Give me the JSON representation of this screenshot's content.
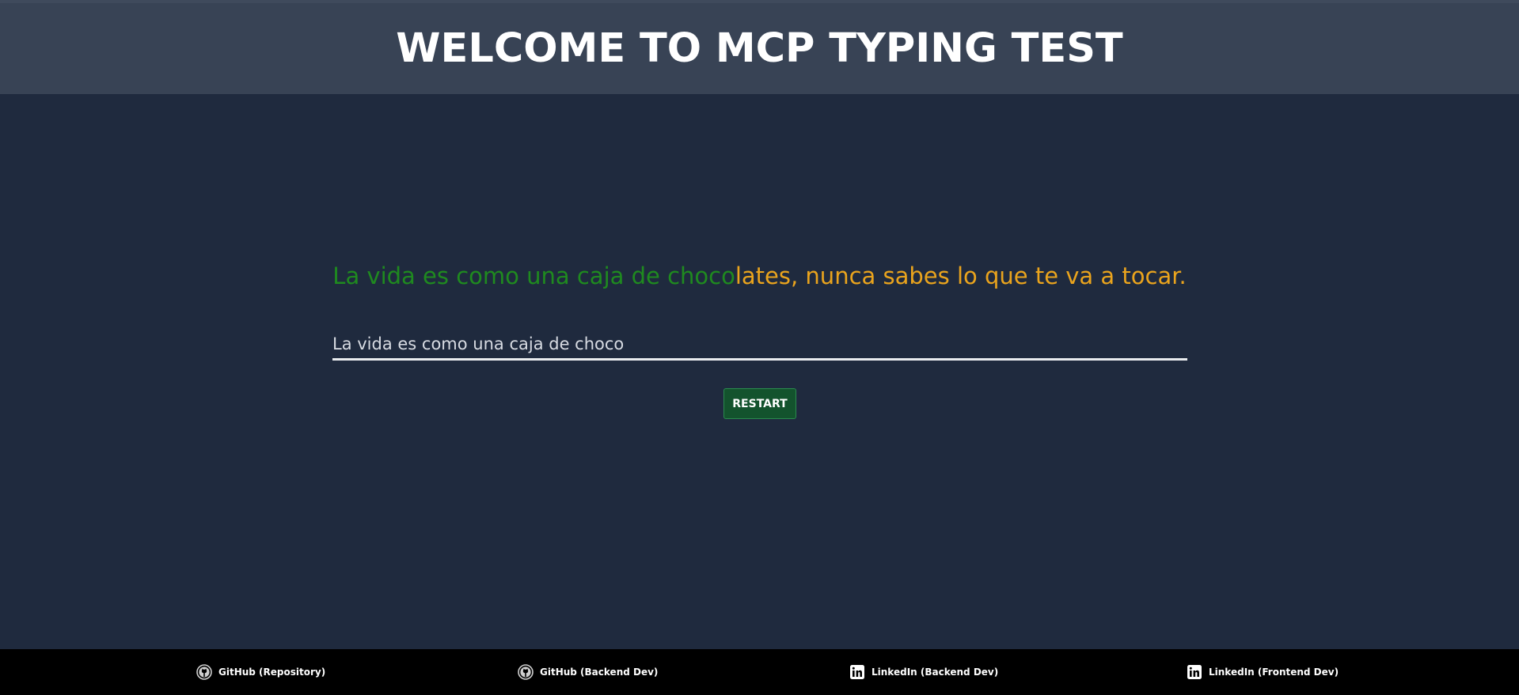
{
  "header": {
    "title": "WELCOME TO MCP TYPING TEST"
  },
  "typing": {
    "typed_text": "La vida es como una caja de choco",
    "remaining_text": "lates, nunca sabes lo que te va a tocar.",
    "input_value": "La vida es como una caja de choco",
    "typed_color": "#1f8a1f",
    "remaining_color": "#eaa41d"
  },
  "controls": {
    "restart_label": "RESTART"
  },
  "footer": {
    "links": [
      {
        "label": "GitHub (Repository)",
        "icon": "github-icon"
      },
      {
        "label": "GitHub (Backend Dev)",
        "icon": "github-icon"
      },
      {
        "label": "LinkedIn (Backend Dev)",
        "icon": "linkedin-icon"
      },
      {
        "label": "LinkedIn (Frontend Dev)",
        "icon": "linkedin-icon"
      }
    ]
  }
}
